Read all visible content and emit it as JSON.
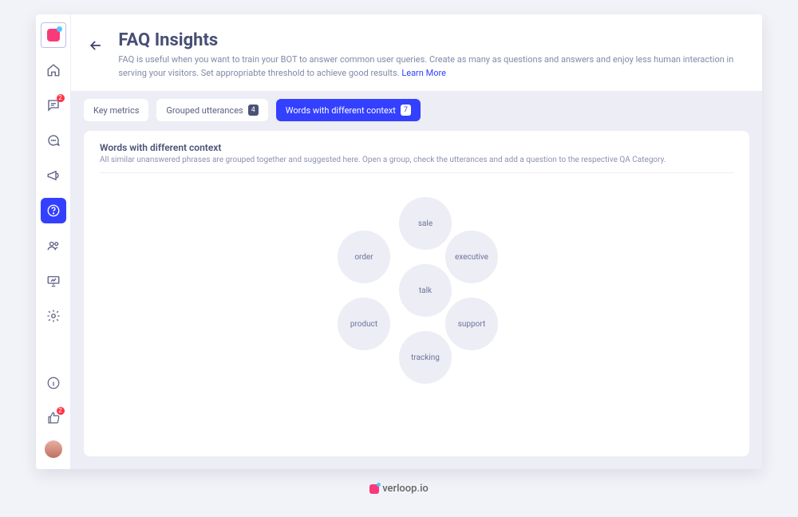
{
  "sidebar": {
    "chat_badge": "2",
    "thumbs_badge": "2"
  },
  "header": {
    "title": "FAQ Insights",
    "desc": "FAQ is useful when you want to train your BOT to answer common user queries. Create as many as questions and answers and enjoy less human interaction in serving your visitors. Set appropriabte threshold to achieve good results. ",
    "learn_more": "Learn More"
  },
  "tabs": {
    "key_metrics": "Key metrics",
    "grouped": "Grouped utterances",
    "grouped_count": "4",
    "words": "Words with different context",
    "words_count": "7"
  },
  "panel": {
    "title": "Words with different context",
    "sub": "All similar unanswered phrases are grouped together and suggested here. Open a group, check the utterances and add a question to the respective QA Category."
  },
  "bubbles": {
    "sale": "sale",
    "order": "order",
    "executive": "executive",
    "talk": "talk",
    "product": "product",
    "support": "support",
    "tracking": "tracking"
  },
  "footer": {
    "brand": "verloop.io"
  }
}
